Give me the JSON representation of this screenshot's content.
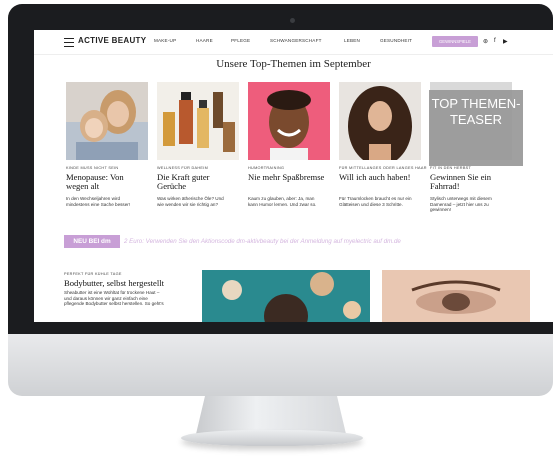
{
  "nav": {
    "logo": "ACTIVE BEAUTY",
    "items": [
      "MAKE-UP",
      "HAARE",
      "PFLEGE",
      "SCHWANGERSCHAFT",
      "LEBEN",
      "GESUNDHEIT"
    ],
    "button": "GEWINNSPIELE",
    "icons": [
      "pinterest-icon",
      "facebook-icon",
      "youtube-icon"
    ]
  },
  "section_title": "Unsere Top-Themen im September",
  "cards": [
    {
      "tag": "KINDE MUSS NICHT SEIN",
      "title": "Menopause: Von wegen alt",
      "text": "In den Wechseljahren wird mindestens eine Sache besser!"
    },
    {
      "tag": "WELLNESS FÜR DAHEIM",
      "title": "Die Kraft guter Gerüche",
      "text": "Was wirken ätherische Öle? Und wie wenden wir sie richtig an?"
    },
    {
      "tag": "HUMORTRAINING",
      "title": "Nie mehr Spaßbremse",
      "text": "Kaum zu glauben, aber: Ja, man kann Humor lernen. Und zwar so."
    },
    {
      "tag": "FÜR MITTELLANGES ODER LANGES HAAR",
      "title": "Will ich auch haben!",
      "text": "Für Traumlocken braucht es nur ein Glätteisen und diese 3 Schritte."
    },
    {
      "tag": "FIT IN DEN HERBST",
      "title": "Gewinnen Sie ein Fahrrad!",
      "text": "Stylisch unterwegs mit diesem Damenrad – jetzt hier uns zu gewinnen!"
    }
  ],
  "teaser_label": "TOP THEMEN-TEASER",
  "promo": {
    "badge": "NEU BEI dm",
    "text": "2 Euro: Verwenden Sie den Aktionscode dm-aktivbeauty bei der Anmeldung auf myelectric auf dm.de"
  },
  "bottom_article": {
    "tag": "PERFEKT FÜR KÜHLE TAGE",
    "title": "Bodybutter, selbst hergestellt",
    "text": "Sheabutter ist eine Wohltat für trockene Haut – und daraus können wir ganz einfach eine pflegende Bodybutter selbst herstellen. So geht's"
  }
}
